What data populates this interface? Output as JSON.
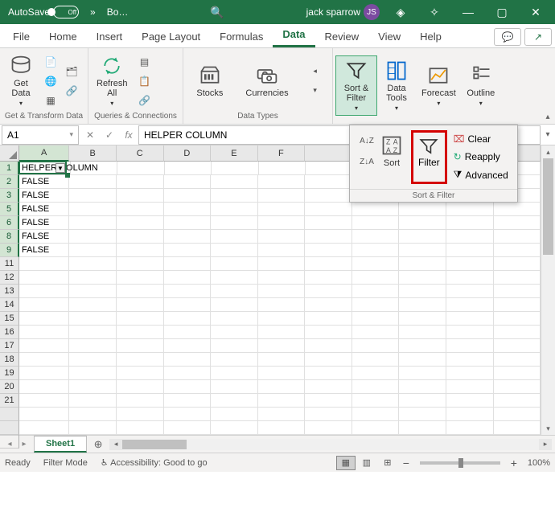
{
  "titlebar": {
    "autosave_label": "AutoSave",
    "autosave_state": "Off",
    "chev": "»",
    "doc_name": "Bo…",
    "user_name": "jack sparrow",
    "user_initials": "JS"
  },
  "tabs": [
    "File",
    "Home",
    "Insert",
    "Page Layout",
    "Formulas",
    "Data",
    "Review",
    "View",
    "Help"
  ],
  "active_tab": "Data",
  "ribbon": {
    "group1": {
      "label": "Get & Transform Data",
      "get_data": "Get\nData"
    },
    "group2": {
      "label": "Queries & Connections",
      "refresh": "Refresh\nAll"
    },
    "group3": {
      "label": "Data Types",
      "stocks": "Stocks",
      "currencies": "Currencies"
    },
    "group4": {
      "label": "",
      "sort_filter": "Sort &\nFilter",
      "data_tools": "Data\nTools",
      "forecast": "Forecast",
      "outline": "Outline"
    }
  },
  "dropdown": {
    "sort_label": "Sort",
    "filter_label": "Filter",
    "clear": "Clear",
    "reapply": "Reapply",
    "advanced": "Advanced",
    "group_label": "Sort & Filter"
  },
  "formula_bar": {
    "name_box": "A1",
    "fx": "fx",
    "value": "HELPER COLUMN"
  },
  "columns": [
    "A",
    "B",
    "C",
    "D",
    "E",
    "F"
  ],
  "visible_rows": [
    1,
    2,
    3,
    5,
    6,
    8,
    9,
    11,
    12,
    13,
    14,
    15,
    16,
    17,
    18,
    19,
    20,
    21
  ],
  "active_rows": [
    1,
    2,
    3,
    5,
    6,
    8,
    9
  ],
  "cells": {
    "1": "HELPER COLUMN",
    "2": "FALSE",
    "3": "FALSE",
    "5": "FALSE",
    "6": "FALSE",
    "8": "FALSE",
    "9": "FALSE"
  },
  "sheet": {
    "name": "Sheet1"
  },
  "status": {
    "ready": "Ready",
    "filter_mode": "Filter Mode",
    "accessibility": "Accessibility: Good to go",
    "zoom": "100%"
  },
  "chart_data": null
}
